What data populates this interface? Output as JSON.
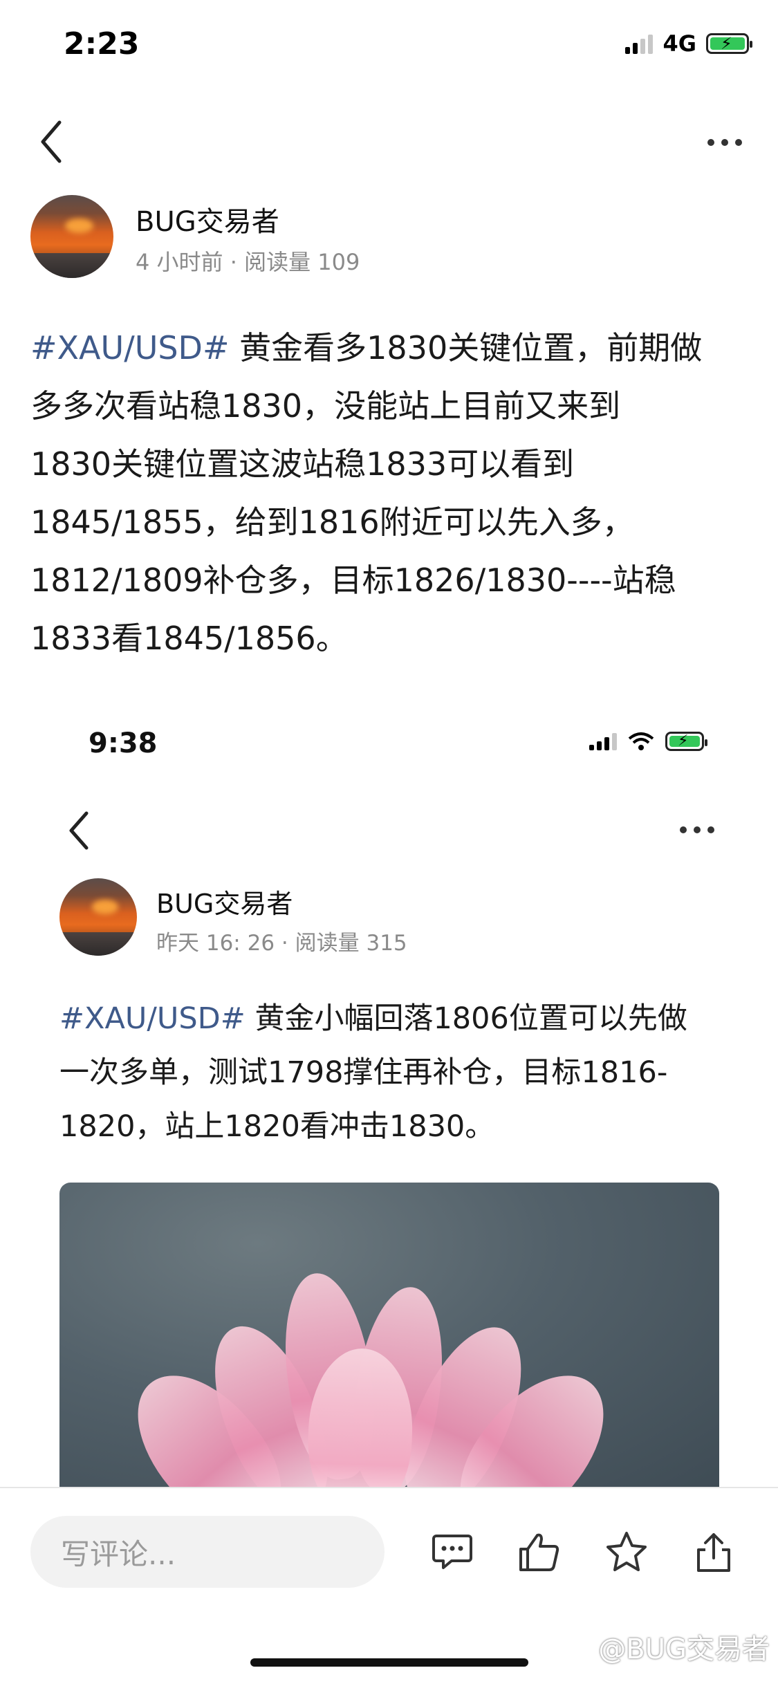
{
  "status_bar_top": {
    "time": "2:23",
    "network": "4G"
  },
  "post1": {
    "author": "BUG交易者",
    "time_label": "4 小时前",
    "separator": "·",
    "reads": "阅读量 109",
    "hashtag": "#XAU/USD#",
    "lines": [
      " 黄金看多1830关键位置，前期做",
      "多多次看站稳1830，没能站上目前又来到",
      "1830关键位置这波站稳1833可以看到",
      "1845/1855，给到1816附近可以先入多，",
      "1812/1809补仓多，目标1826/1830----站稳",
      "1833看1845/1856。"
    ]
  },
  "status_bar_inner": {
    "time": "9:38"
  },
  "post2": {
    "author": "BUG交易者",
    "time_label": "昨天 16: 26",
    "separator": "·",
    "reads": "阅读量 315",
    "hashtag": "#XAU/USD#",
    "lines": [
      " 黄金小幅回落1806位置可以先做",
      "一次多单，测试1798撑住再补仓，目标1816-",
      "1820，站上1820看冲击1830。"
    ]
  },
  "bottom_bar": {
    "comment_placeholder": "写评论...",
    "icons": [
      "comment-icon",
      "like-icon",
      "star-icon",
      "share-icon"
    ]
  },
  "watermark": "@BUG交易者",
  "colors": {
    "hashtag": "#3f5a8a",
    "battery": "#33c759",
    "meta": "#8a8a8a"
  }
}
